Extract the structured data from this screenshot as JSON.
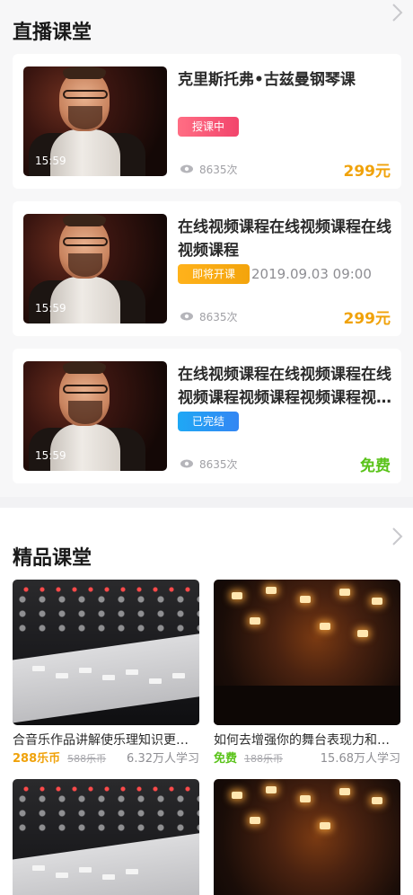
{
  "live": {
    "title": "直播课堂",
    "items": [
      {
        "title": "克里斯托弗•古兹曼钢琴课",
        "status": "授课中",
        "start_time": "",
        "duration": "15:59",
        "views": "8635次",
        "price": "299元"
      },
      {
        "title": "在线视频课程在线视频课程在线视频课程",
        "status": "即将开课",
        "start_time": "2019.09.03   09:00",
        "duration": "15:59",
        "views": "8635次",
        "price": "299元"
      },
      {
        "title": "在线视频课程在线视频课程在线视频课程视频课程视频课程视频课程",
        "status": "已完结",
        "start_time": "",
        "duration": "15:59",
        "views": "8635次",
        "price": "免费"
      }
    ]
  },
  "featured": {
    "title": "精品课堂",
    "items": [
      {
        "title": "合音乐作品讲解使乐理知识更加丰富",
        "price": "288乐币",
        "original_price": "588乐币",
        "learners": "6.32万人学习"
      },
      {
        "title": "如何去增强你的舞台表现力和感染力",
        "price": "免费",
        "original_price": "188乐币",
        "learners": "15.68万人学习"
      }
    ]
  },
  "colors": {
    "badge_live": "#f2456c",
    "badge_soon": "#f3a40c",
    "badge_done": "#3386f3",
    "price_paid": "#f0a20a",
    "price_free": "#5ac31a"
  }
}
